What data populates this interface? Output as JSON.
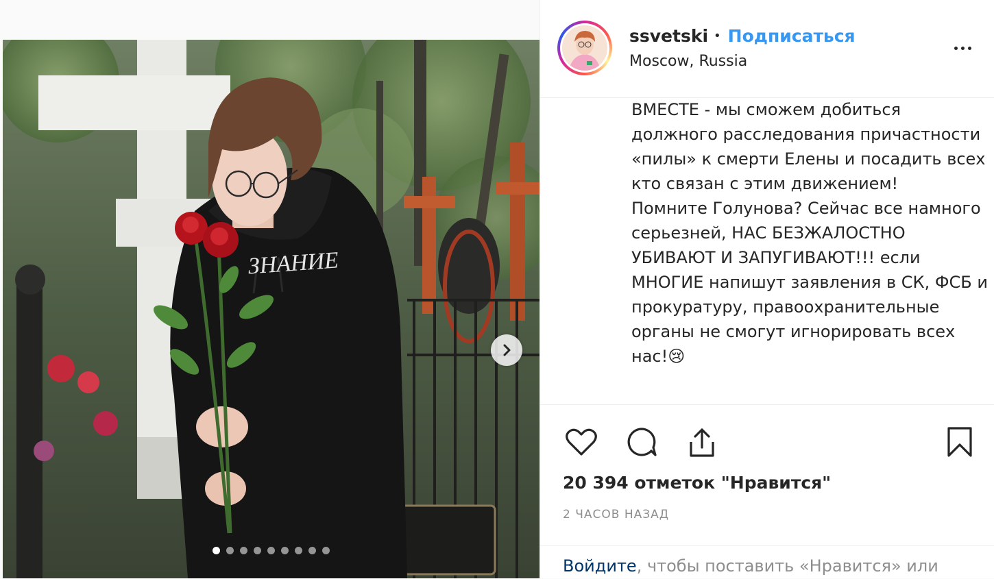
{
  "post": {
    "username": "ssvetski",
    "separator": "•",
    "follow_label": "Подписаться",
    "location": "Moscow, Russia",
    "more_icon": "more-horizontal-icon",
    "caption": "ВМЕСТЕ - мы сможем добиться должного расследования причастности «пилы» к смерти Елены и посадить всех кто связан с этим движением!\nПомните Голунова? Сейчас все намного серьезней, НАС БЕЗЖАЛОСТНО УБИВАЮТ И ЗАПУГИВАЮТ!!! если МНОГИЕ напишут заявления в СК, ФСБ и прокуратуру, правоохранительные органы не смогут игнорировать всех нас!😢",
    "likes": "20 394 отметок \"Нравится\"",
    "timestamp": "2 ЧАСОВ НАЗАД",
    "login_link": "Войдите",
    "login_rest": ", чтобы поставить «Нравится» или"
  },
  "carousel": {
    "image_count": 9,
    "active_index": 0,
    "next_icon": "chevron-right-icon",
    "hoodie_text": "ЗНАНИЕ"
  },
  "icons": {
    "like": "heart-icon",
    "comment": "comment-icon",
    "share": "share-icon",
    "save": "bookmark-icon"
  },
  "colors": {
    "follow": "#3897f0",
    "text": "#262626",
    "muted": "#8e8e8e",
    "link": "#003569"
  }
}
